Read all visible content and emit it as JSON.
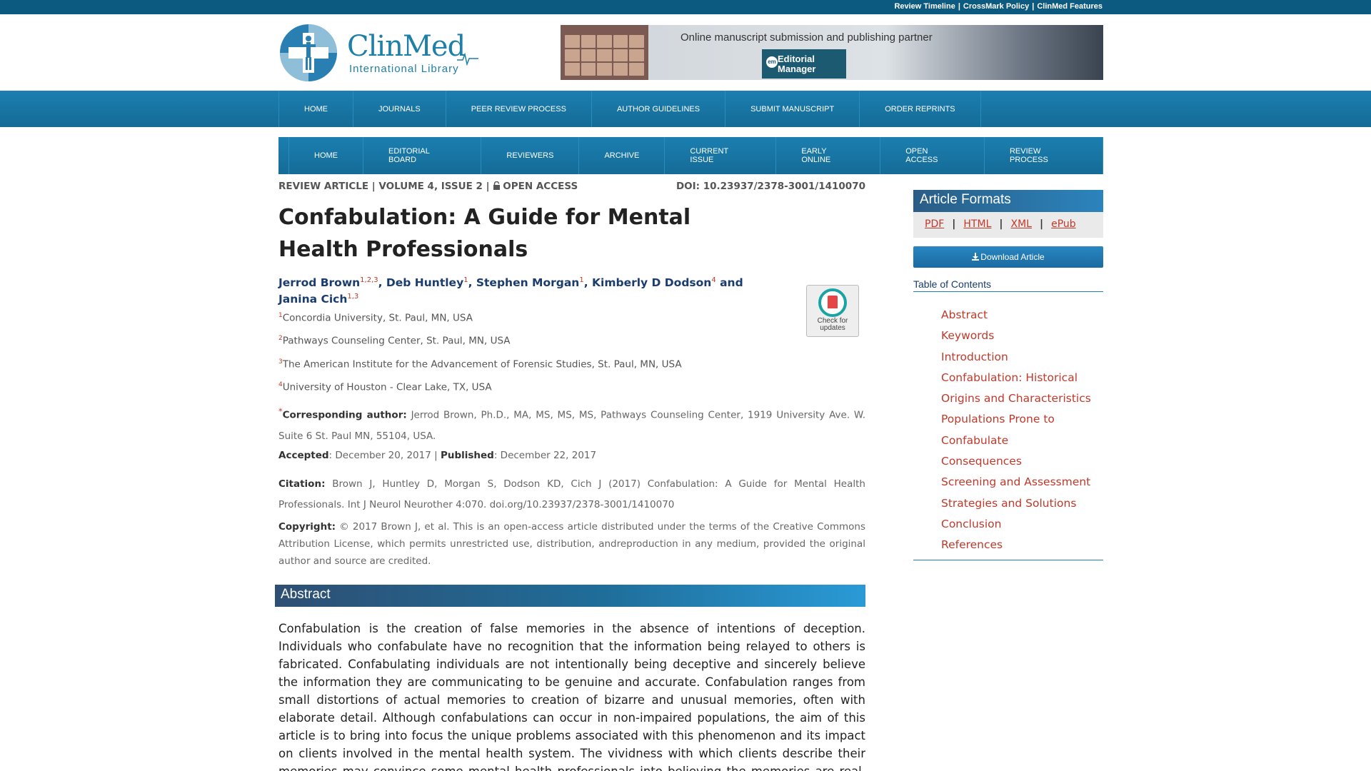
{
  "toplinks": [
    "Review Timeline",
    "CrossMark Policy",
    "ClinMed Features"
  ],
  "logo": {
    "name": "ClinMed",
    "subtitle": "International Library"
  },
  "banner": {
    "text": "Online manuscript submission and publishing partner",
    "badge_line1": "Editorial",
    "badge_line2": "Manager",
    "badge_mark": "em"
  },
  "main_nav": [
    "Home",
    "Journals",
    "Peer Review Process",
    "Author Guidelines",
    "Submit Manuscript",
    "Order Reprints"
  ],
  "journal_nav": [
    "Home",
    "Editorial Board",
    "Reviewers",
    "Archive",
    "Current Issue",
    "Early Online",
    "Open Access",
    "Review Process"
  ],
  "article": {
    "meta": "REVIEW ARTICLE | VOLUME 4, ISSUE 2 | ",
    "access": "OPEN ACCESS",
    "doi": "DOI: 10.23937/2378-3001/1410070",
    "title": "Confabulation: A Guide for Mental Health Professionals",
    "authors": [
      {
        "name": "Jerrod Brown",
        "sup": "1,2,3",
        "sep": ", "
      },
      {
        "name": "Deb Huntley",
        "sup": "1",
        "sep": ", "
      },
      {
        "name": "Stephen Morgan",
        "sup": "1",
        "sep": ", "
      },
      {
        "name": "Kimberly D Dodson",
        "sup": "4",
        "sep": " and "
      },
      {
        "name": "Janina Cich",
        "sup": "1,3",
        "sep": ""
      }
    ],
    "check_updates": "Check for updates",
    "affiliations": [
      {
        "num": "1",
        "text": "Concordia University, St. Paul, MN, USA"
      },
      {
        "num": "2",
        "text": "Pathways Counseling Center, St. Paul, MN, USA"
      },
      {
        "num": "3",
        "text": "The American Institute for the Advancement of Forensic Studies, St. Paul, MN, USA"
      },
      {
        "num": "4",
        "text": "University of Houston - Clear Lake, TX, USA"
      }
    ],
    "corresponding_mark": "*",
    "corresponding_label": "Corresponding author:",
    "corresponding_text": " Jerrod Brown, Ph.D., MA, MS, MS, MS, Pathways Counseling Center, 1919 University Ave. W. Suite 6 St. Paul MN, 55104, USA.",
    "accepted_label": "Accepted",
    "accepted_date": ": December 20, 2017 | ",
    "published_label": "Published",
    "published_date": ": December 22, 2017",
    "citation_label": "Citation:",
    "citation_text": " Brown J, Huntley D, Morgan S, Dodson KD, Cich J (2017) Confabulation: A Guide for Mental Health Professionals. Int J Neurol Neurother 4:070. doi.org/10.23937/2378-3001/1410070",
    "copyright_label": "Copyright:",
    "copyright_text": " © 2017 Brown J, et al. This is an open-access article distributed under the terms of the Creative Commons Attribution License, which permits unrestricted use, distribution, andreproduction in any medium, provided the original author and source are credited.",
    "abstract_heading": "Abstract",
    "abstract_text": "Confabulation is the creation of false memories in the absence of intentions of deception. Individuals who confabulate have no recognition that the information being relayed to others is fabricated. Confabulating individuals are not intentionally being deceptive and sincerely believe the information they are communicating to be genuine and accurate. Confabulation ranges from small distortions of actual memories to creation of bizarre and unusual memories, often with elaborate detail. Although confabulations can occur in non-impaired populations, the aim of this article is to bring into focus the unique problems associated with this phenomenon and its impact on clients involved in the mental health system. The vividness with which clients describe their memories may convince some mental health professionals into believing the memories are real. Even when the client is presented with information"
  },
  "sidebar": {
    "formats_heading": "Article Formats",
    "formats": [
      "PDF",
      "HTML",
      "XML",
      "ePub"
    ],
    "download": "Download Article",
    "toc_title": "Table of Contents",
    "toc": [
      "Abstract",
      "Keywords",
      "Introduction",
      "Confabulation: Historical Origins and Characteristics",
      "Populations Prone to Confabulate",
      "Consequences",
      "Screening and Assessment",
      "Strategies and Solutions",
      "Conclusion",
      "References"
    ]
  },
  "colors": {
    "brand_blue": "#1b7fb0",
    "link_red": "#c0392b",
    "author_navy": "#1a3c6e"
  }
}
